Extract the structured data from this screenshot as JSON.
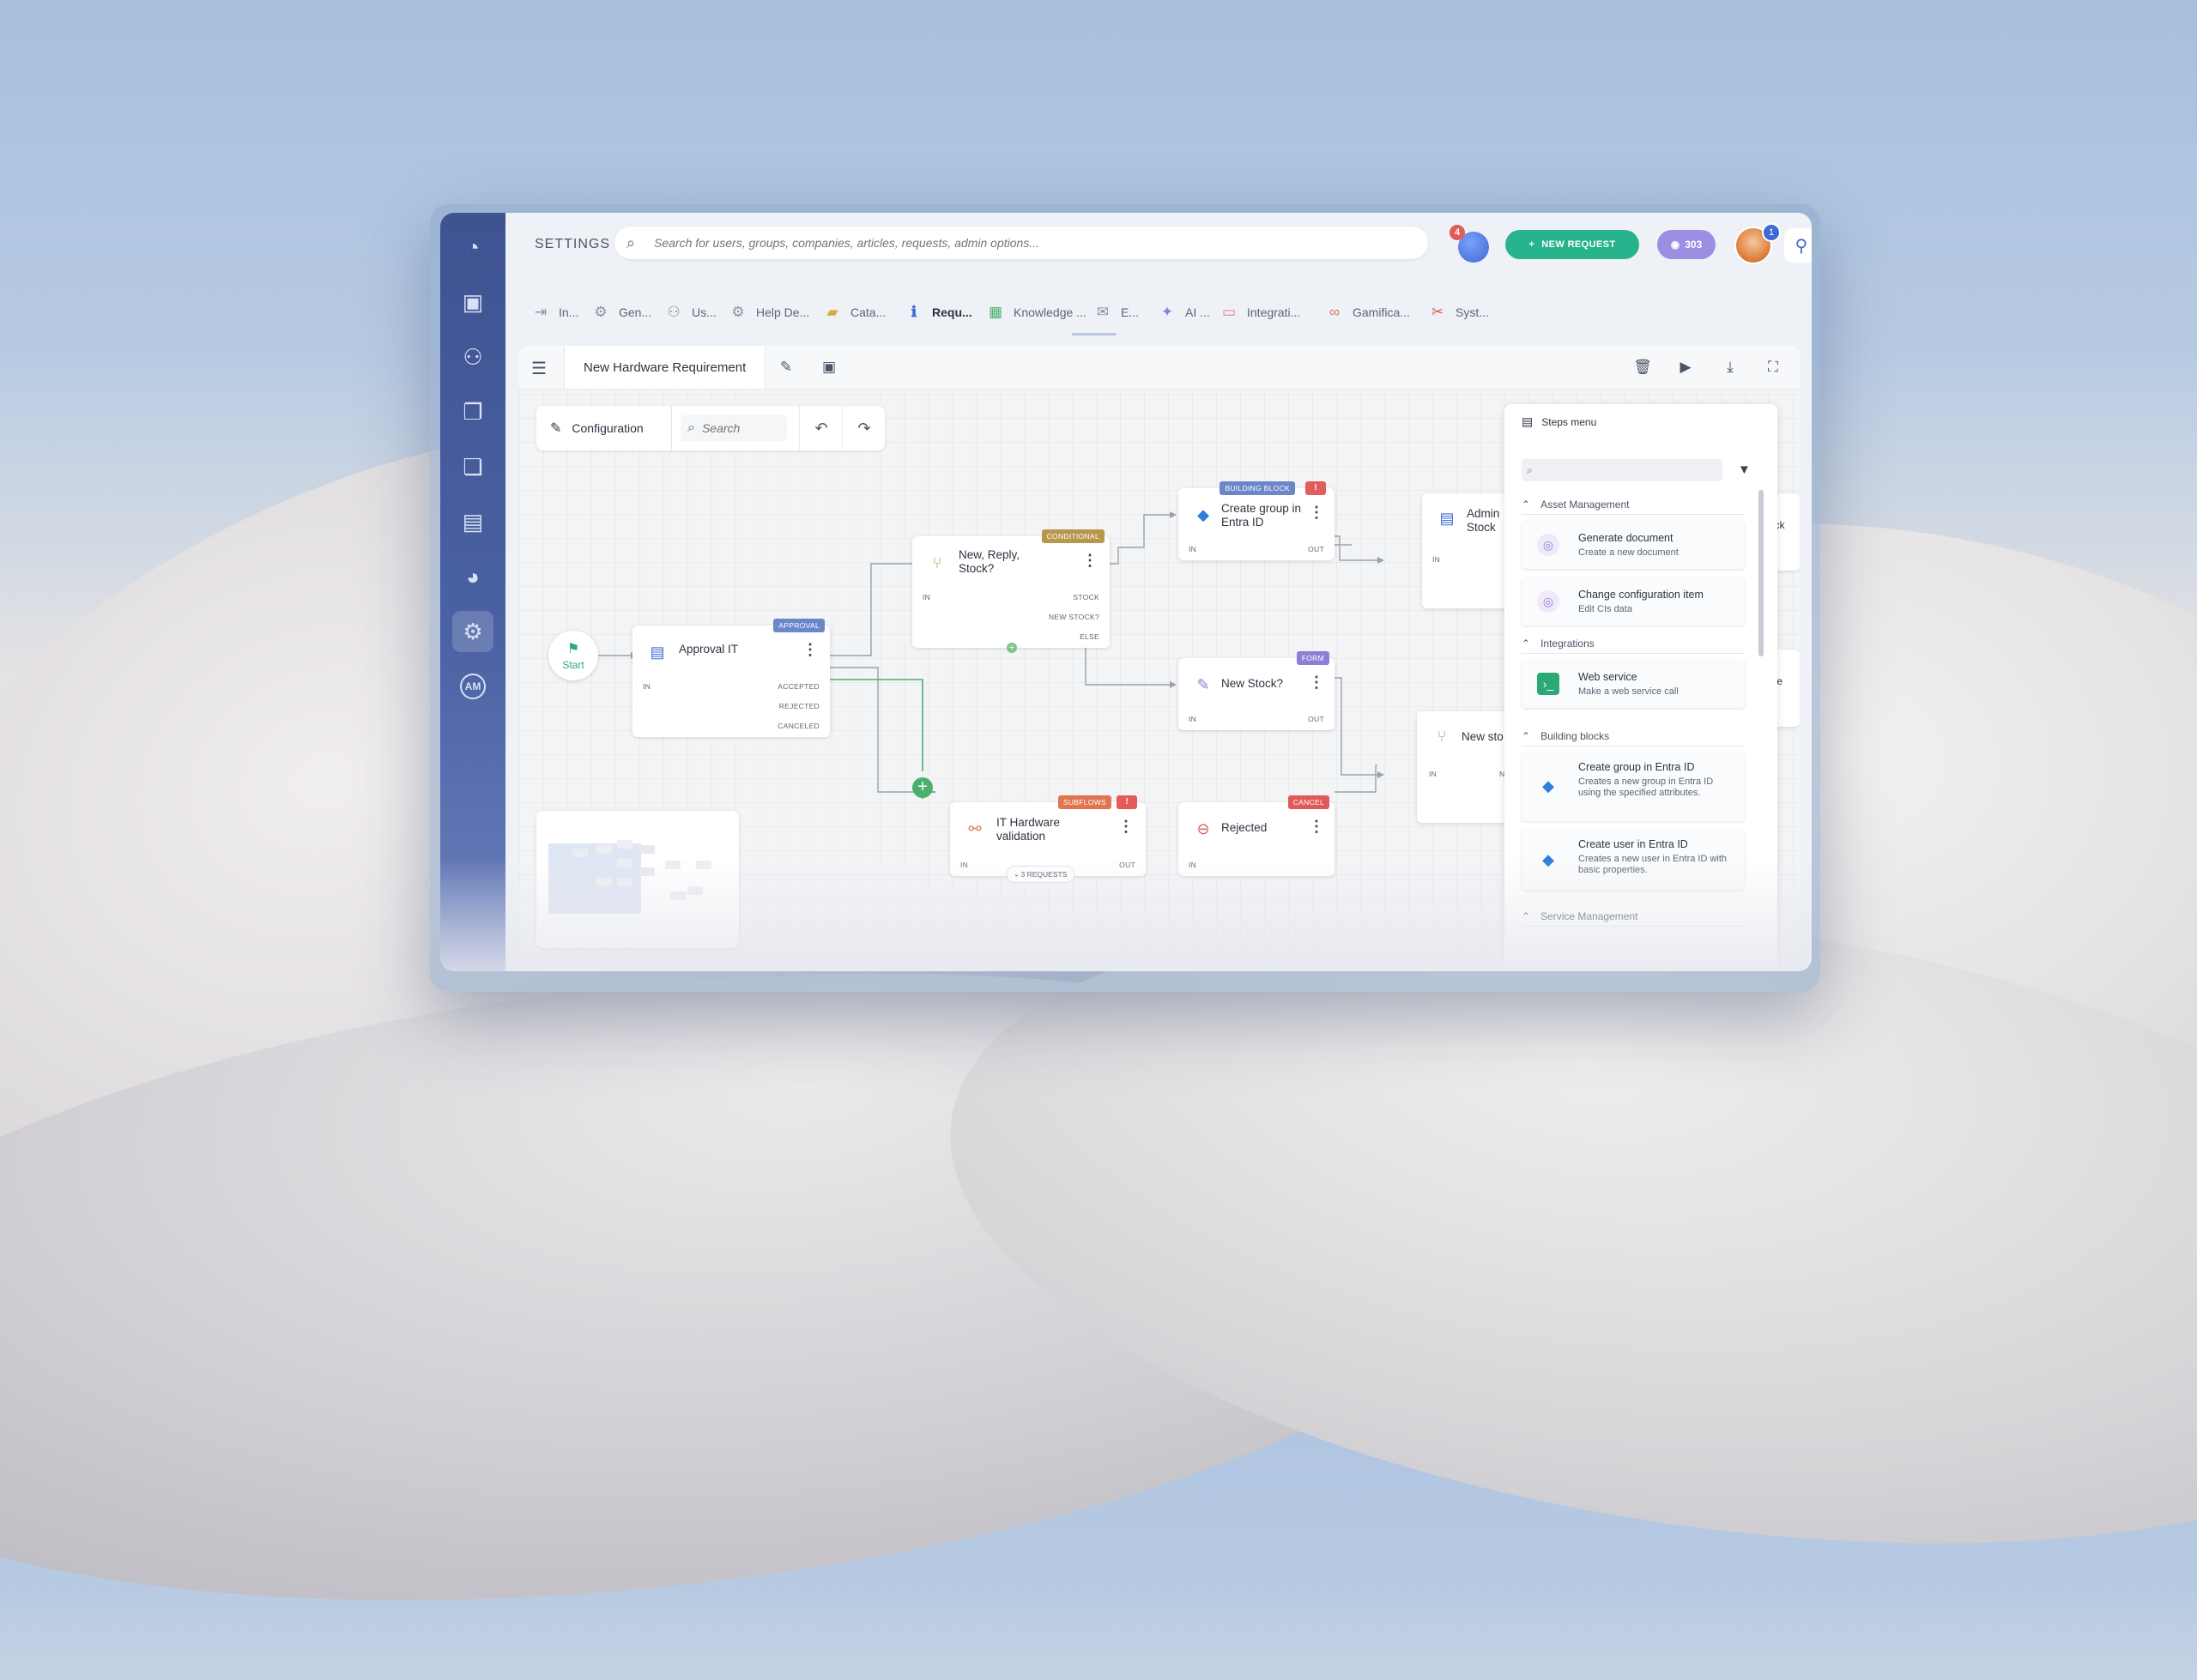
{
  "topbar": {
    "section_label": "SETTINGS",
    "search_placeholder": "Search for users, groups, companies, articles, requests, admin options...",
    "notifications_count": "4",
    "new_request_label": "NEW REQUEST",
    "points_value": "303",
    "avatar_badge": "1"
  },
  "sidebar": {
    "items": [
      {
        "icon": "dashboard-icon"
      },
      {
        "icon": "briefcase-icon"
      },
      {
        "icon": "users-icon"
      },
      {
        "icon": "documents-icon"
      },
      {
        "icon": "files-icon"
      },
      {
        "icon": "book-icon"
      },
      {
        "icon": "pie-chart-icon"
      },
      {
        "icon": "gear-icon",
        "active": true
      },
      {
        "icon": "am-icon",
        "label": "AM"
      }
    ]
  },
  "tabs": [
    {
      "label": "In...",
      "icon": "inbox-icon"
    },
    {
      "label": "Gen...",
      "icon": "gear-icon"
    },
    {
      "label": "Us...",
      "icon": "users-icon"
    },
    {
      "label": "Help De...",
      "icon": "helpdesk-icon"
    },
    {
      "label": "Cata...",
      "icon": "folder-icon"
    },
    {
      "label": "Requ...",
      "icon": "request-icon",
      "active": true
    },
    {
      "label": "Knowledge ...",
      "icon": "knowledge-icon"
    },
    {
      "label": "E...",
      "icon": "email-icon"
    },
    {
      "label": "AI ...",
      "icon": "ai-icon"
    },
    {
      "label": "Integrati...",
      "icon": "integration-icon"
    },
    {
      "label": "Gamifica...",
      "icon": "gamification-icon"
    },
    {
      "label": "Syst...",
      "icon": "system-icon"
    }
  ],
  "editor": {
    "tab_title": "New Hardware Requirement",
    "configuration_label": "Configuration",
    "search_placeholder": "Search"
  },
  "workflow": {
    "start_label": "Start",
    "nodes": {
      "approval": {
        "title": "Approval IT",
        "tag": "APPROVAL",
        "ports": {
          "in": "IN",
          "accepted": "ACCEPTED",
          "rejected": "REJECTED",
          "canceled": "CANCELED"
        }
      },
      "conditional": {
        "title": "New, Reply, Stock?",
        "tag": "CONDITIONAL",
        "ports": {
          "in": "IN",
          "stock": "STOCK",
          "new_stock": "NEW STOCK?",
          "else": "ELSE"
        }
      },
      "create_group": {
        "title": "Create group in Entra ID",
        "tag": "BUILDING BLOCK",
        "alert": "!",
        "ports": {
          "in": "IN",
          "out": "OUT"
        }
      },
      "new_stock": {
        "title": "New Stock?",
        "tag": "FORM",
        "ports": {
          "in": "IN",
          "out": "OUT"
        }
      },
      "hardware": {
        "title": "IT Hardware validation",
        "tag": "SUBFLOWS",
        "alert": "!",
        "requests": "3 REQUESTS",
        "ports": {
          "in": "IN",
          "out": "OUT"
        }
      },
      "rejected": {
        "title": "Rejected",
        "tag": "CANCEL",
        "ports": {
          "in": "IN"
        }
      },
      "admin_stock": {
        "title": "Admin Stock",
        "ports": {
          "in": "IN"
        }
      },
      "new_stock_2": {
        "title": "New sto",
        "ports": {
          "in": "IN",
          "n": "N"
        }
      },
      "partial_1": {
        "title": "ock"
      },
      "partial_2": {
        "title": "cte"
      }
    }
  },
  "steps_menu": {
    "title": "Steps menu",
    "categories": [
      {
        "label": "Asset Management"
      },
      {
        "label": "Integrations"
      },
      {
        "label": "Building blocks"
      },
      {
        "label": "Service Management"
      }
    ],
    "items": [
      {
        "title": "Generate document",
        "desc": "Create a new document"
      },
      {
        "title": "Change configuration item",
        "desc": "Edit CIs data"
      },
      {
        "title": "Web service",
        "desc": "Make a web service call"
      },
      {
        "title": "Create group in Entra ID",
        "desc": "Creates a new group in Entra ID using the specified attributes."
      },
      {
        "title": "Create user in Entra ID",
        "desc": "Creates a new user in Entra ID with basic properties."
      }
    ]
  },
  "colors": {
    "approval_tag": "#6b86c9",
    "conditional_tag": "#b7974c",
    "building_block_tag": "#6b86c9",
    "form_tag": "#8e7fd6",
    "subflows_tag": "#e0764f",
    "cancel_tag": "#e05a5a",
    "accent_green": "#27b38b"
  }
}
